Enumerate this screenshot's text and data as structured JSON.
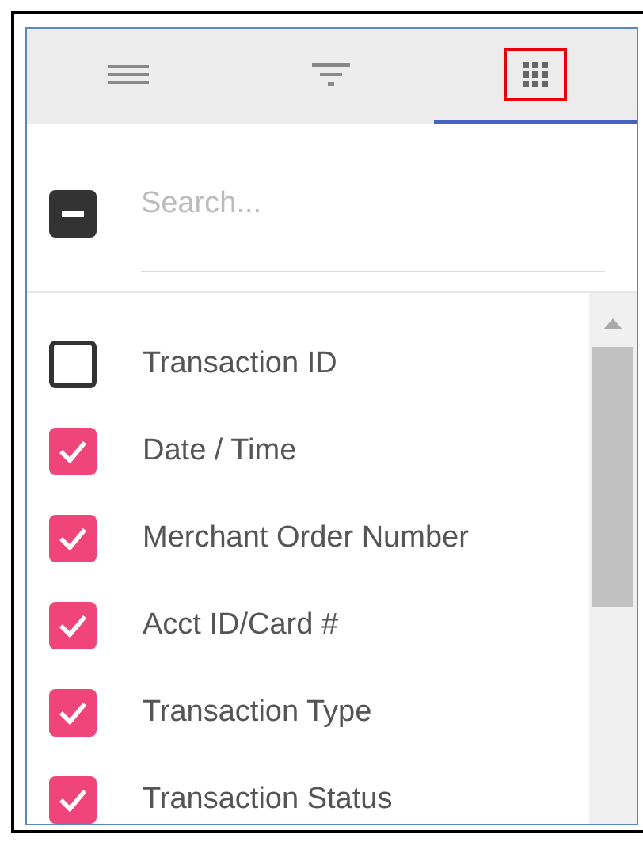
{
  "tabs": [
    {
      "kind": "list",
      "selected": false
    },
    {
      "kind": "filter",
      "selected": false
    },
    {
      "kind": "grid",
      "selected": true,
      "highlighted": true
    }
  ],
  "select_all": {
    "indeterminate": true
  },
  "search": {
    "placeholder": "Search..."
  },
  "columns": [
    {
      "label": "Transaction ID",
      "checked": false
    },
    {
      "label": "Date / Time",
      "checked": true
    },
    {
      "label": "Merchant Order Number",
      "checked": true
    },
    {
      "label": "Acct ID/Card #",
      "checked": true
    },
    {
      "label": "Transaction Type",
      "checked": true
    },
    {
      "label": "Transaction Status",
      "checked": true
    }
  ]
}
